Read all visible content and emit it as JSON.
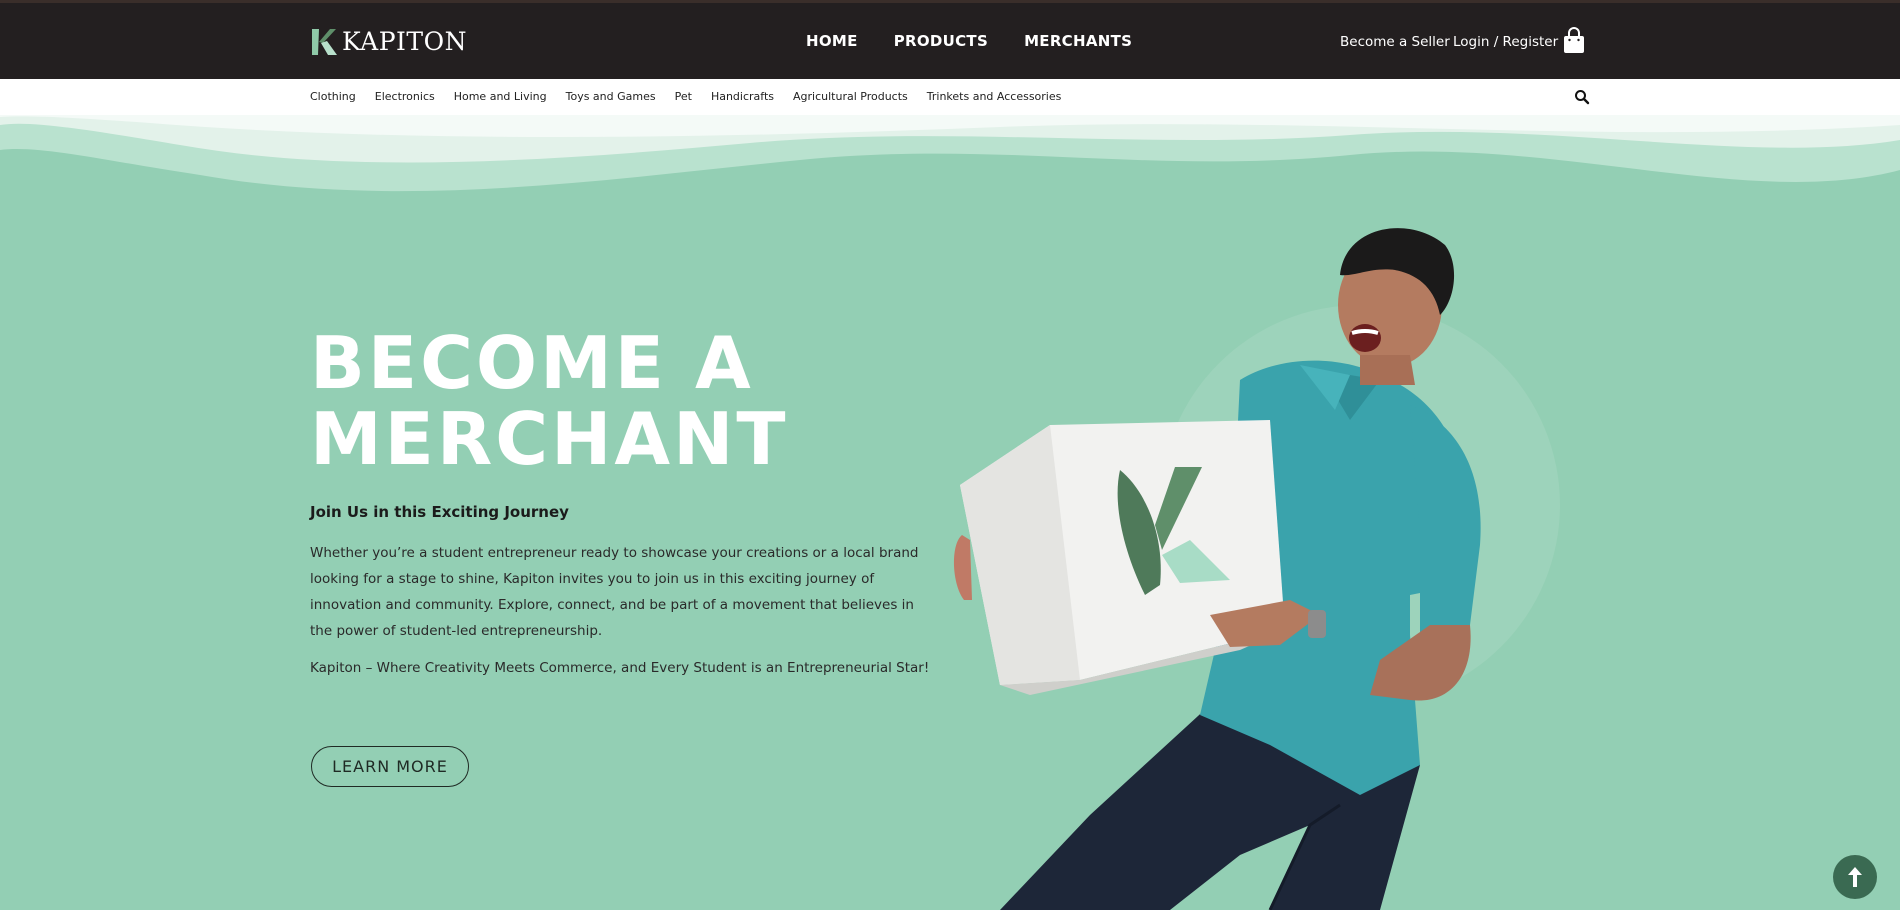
{
  "brand": {
    "name": "KAPITON"
  },
  "main_nav": [
    "HOME",
    "PRODUCTS",
    "MERCHANTS"
  ],
  "top_links": {
    "seller": "Become a Seller",
    "login": "Login / Register"
  },
  "categories": [
    "Clothing",
    "Electronics",
    "Home and Living",
    "Toys and Games",
    "Pet",
    "Handicrafts",
    "Agricultural Products",
    "Trinkets and Accessories"
  ],
  "hero": {
    "title_line1": "BECOME A",
    "title_line2": "MERCHANT",
    "subtitle": "Join Us in this Exciting Journey",
    "paragraph": "Whether you’re a student entrepreneur ready to showcase your creations or a local brand looking for a stage to shine, Kapiton invites you to join us in this exciting journey of innovation and community. Explore, connect, and be part of a movement that believes in the power of student-led entrepreneurship.",
    "tagline": "Kapiton – Where Creativity Meets Commerce, and Every Student is an Entrepreneurial Star!",
    "button": "LEARN MORE"
  },
  "icons": {
    "cart": "shopping-bag-icon",
    "search": "search-icon",
    "scroll_top": "arrow-up-icon"
  },
  "colors": {
    "header": "#231f20",
    "hero_bg": "#93cfb4",
    "accent": "#3a6a52",
    "shirt": "#3aa3ac"
  }
}
